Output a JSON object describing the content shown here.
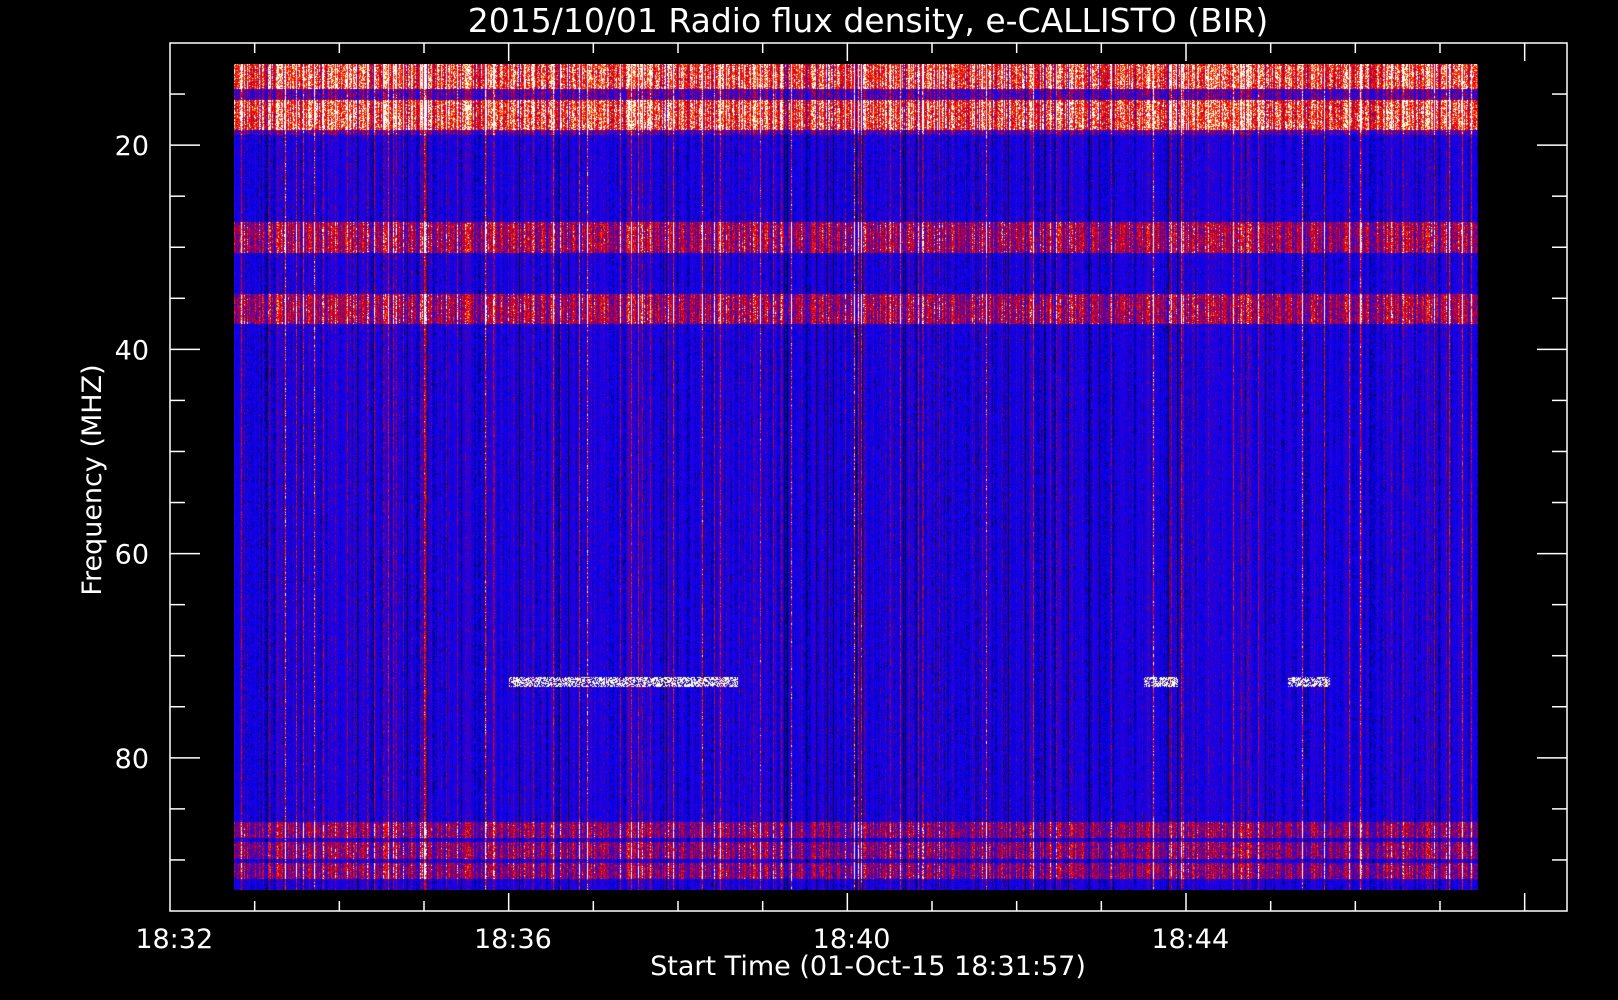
{
  "chart_data": {
    "type": "heatmap",
    "title": "2015/10/01  Radio flux density, e-CALLISTO (BIR)",
    "xlabel": "Start Time (01-Oct-15 18:31:57)",
    "ylabel": "Frequency (MHZ)",
    "x_start": "18:31:57",
    "x_end": "18:47:00",
    "xlim_minutes": [
      0,
      16.5
    ],
    "ylim": [
      95,
      10
    ],
    "y_inverted": true,
    "x_tick_labels": [
      "18:32",
      "18:36",
      "18:40",
      "18:44"
    ],
    "y_tick_labels": [
      "20",
      "40",
      "60",
      "80"
    ],
    "data_time_range": [
      "18:32:22",
      "18:47:24"
    ],
    "data_freq_range_mhz": [
      10,
      94
    ],
    "colormap": [
      "#000000",
      "#0000ff",
      "#a00000",
      "#ff2000",
      "#ffff80"
    ],
    "bright_bands_mhz": [
      13,
      17,
      29,
      36
    ],
    "bright_burst_mhz": 72.5,
    "burst_windows": [
      [
        4.0,
        6.7
      ],
      [
        11.5,
        11.9
      ],
      [
        13.2,
        13.7
      ]
    ],
    "rfi_bands_mhz": [
      87,
      89,
      91
    ],
    "grid": false,
    "legend": "none"
  }
}
